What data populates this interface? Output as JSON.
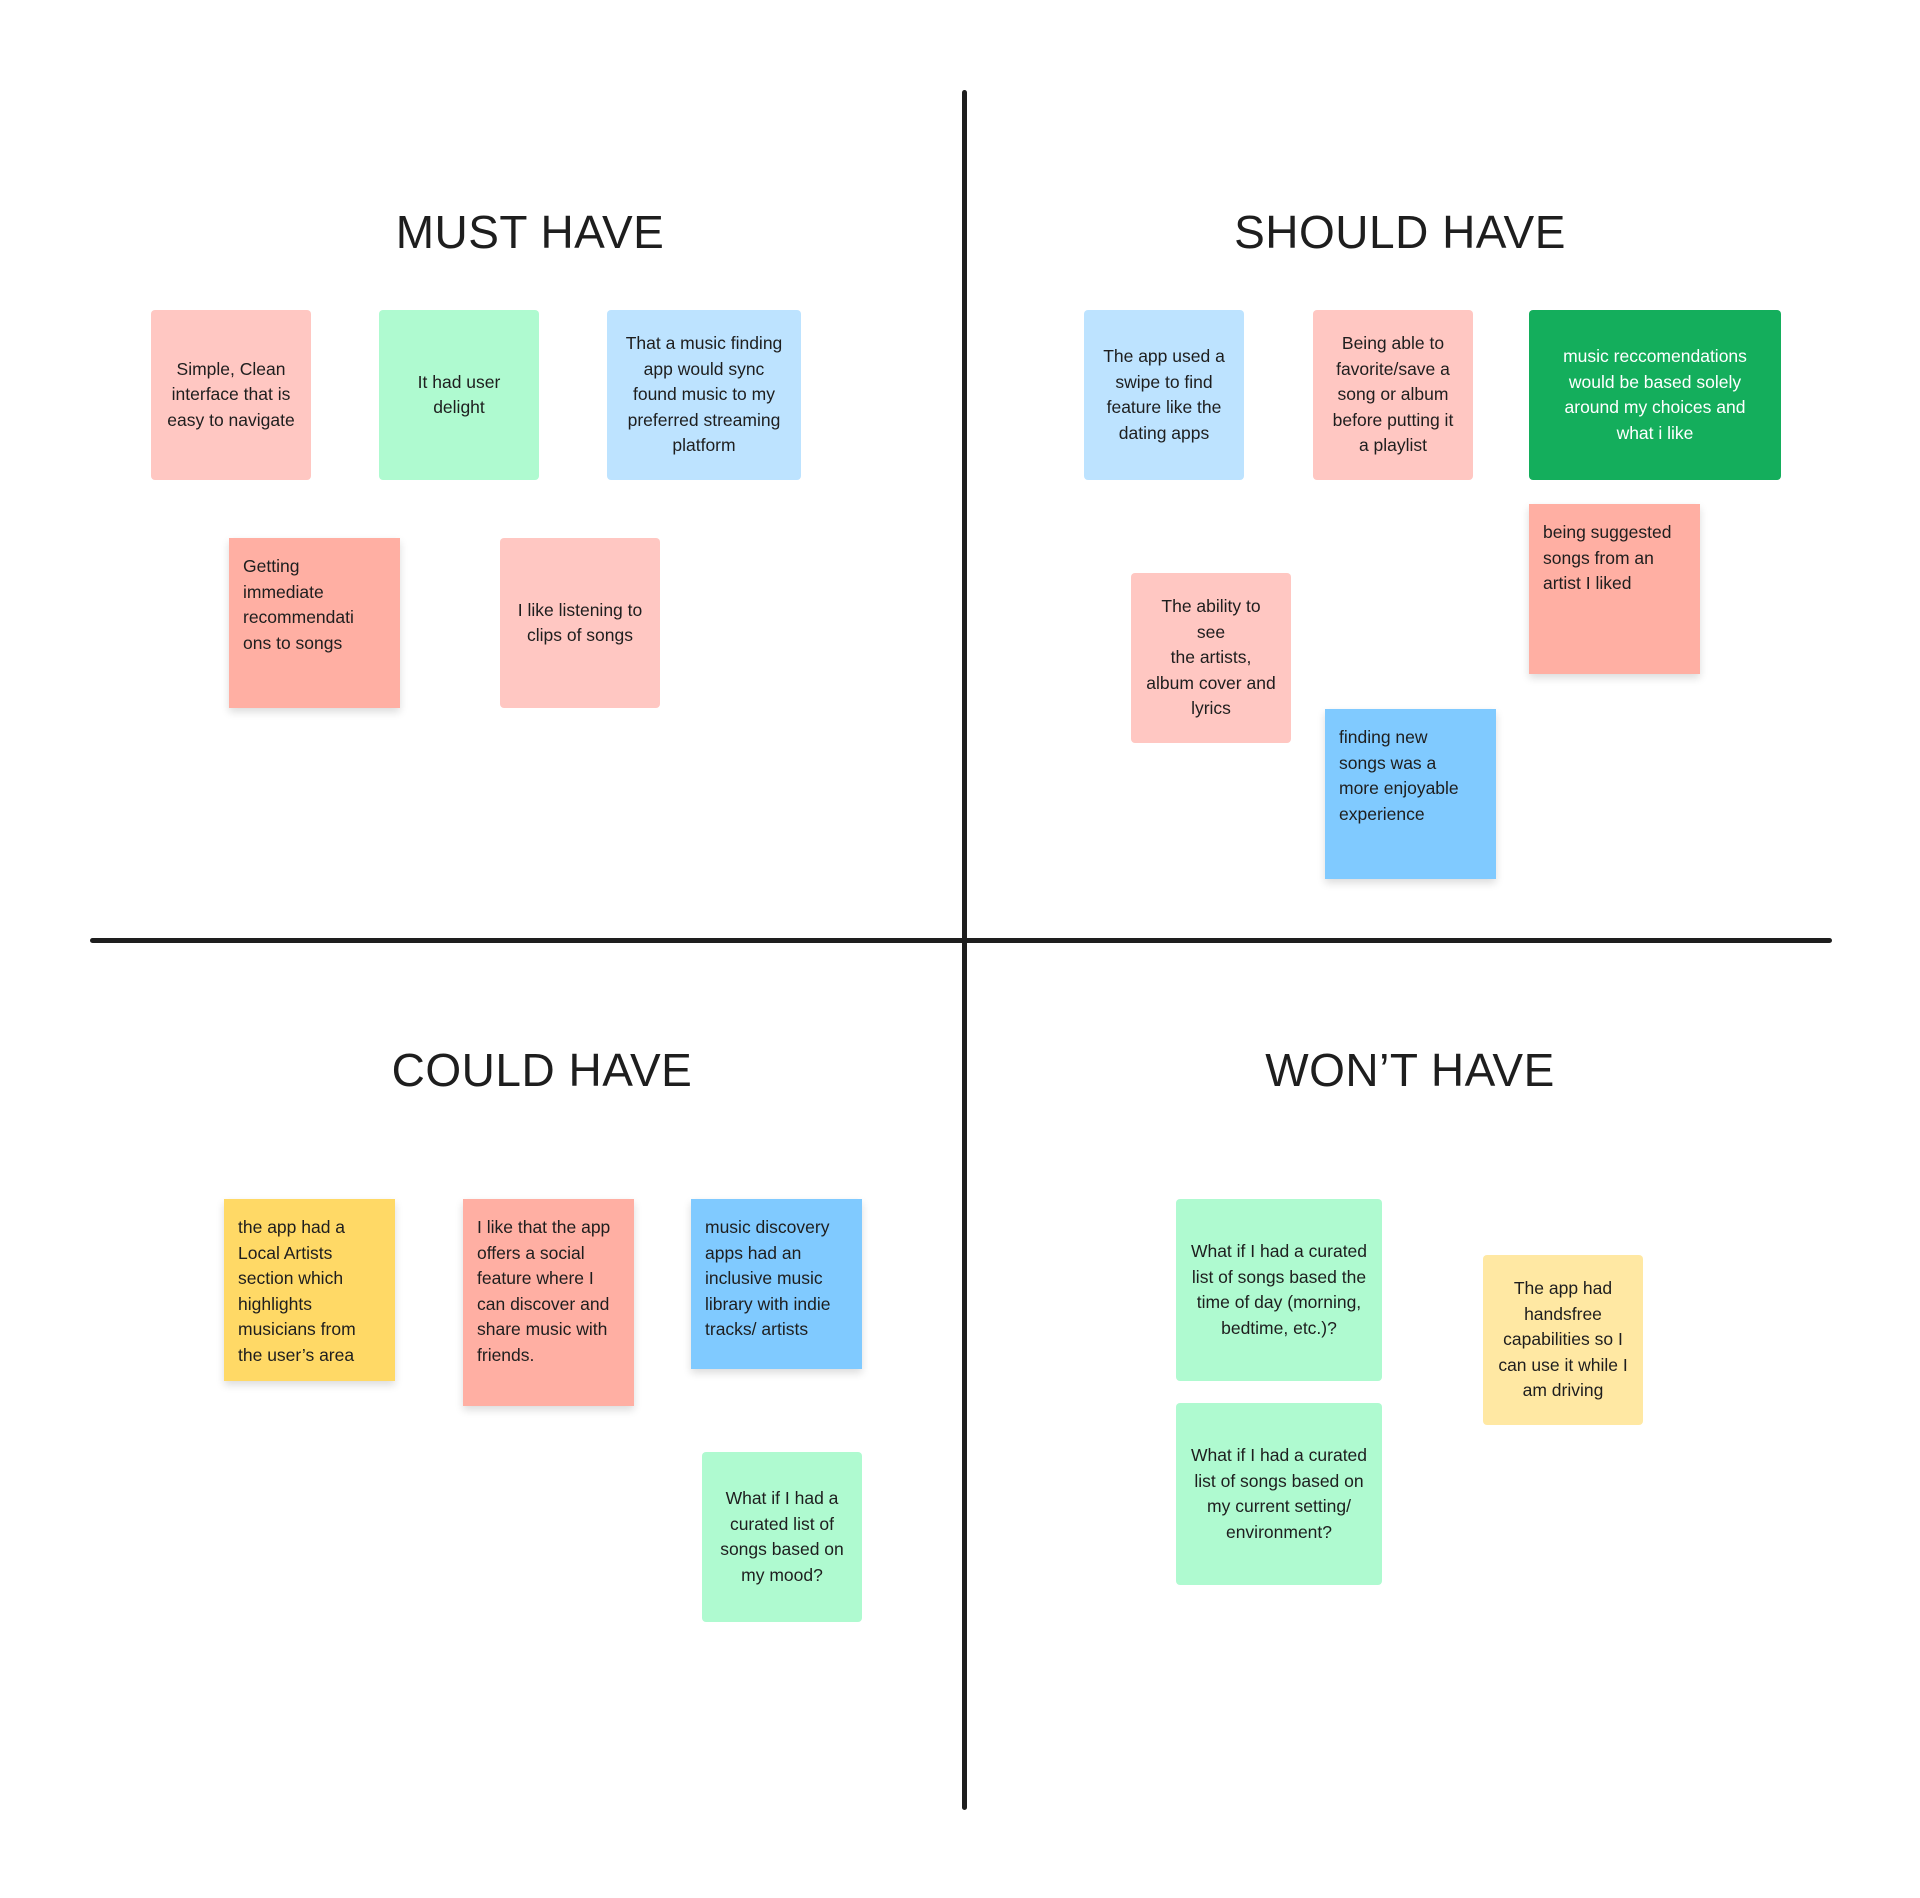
{
  "board": {
    "quadrants": [
      {
        "title": "MUST HAVE",
        "notes": [
          {
            "text": "Simple, Clean\ninterface that is\neasy to navigate",
            "color": "#ffc7c2"
          },
          {
            "text": "It had user\ndelight",
            "color": "#affad0"
          },
          {
            "text": "That a music finding\napp would sync\nfound music to my\npreferred streaming\nplatform",
            "color": "#bde3ff"
          },
          {
            "text": "Getting\nimmediate\nrecommendati\nons to songs",
            "color": "#ffafa3"
          },
          {
            "text": "I like listening to\nclips of songs",
            "color": "#ffc7c2"
          }
        ]
      },
      {
        "title": "SHOULD HAVE",
        "notes": [
          {
            "text": "The app used a\nswipe to find\nfeature like the\ndating apps",
            "color": "#bde3ff"
          },
          {
            "text": "Being able to\nfavorite/save a\nsong or album\nbefore putting it\na playlist",
            "color": "#ffc7c2"
          },
          {
            "text": "music reccomendations\nwould be based solely\naround my choices and\nwhat i like",
            "color": "#14ae5c"
          },
          {
            "text": "being suggested\nsongs from an\nartist I liked",
            "color": "#ffafa3"
          },
          {
            "text": "The ability to see\nthe artists,\nalbum cover and\nlyrics",
            "color": "#ffc7c2"
          },
          {
            "text": "finding new\nsongs was a\nmore enjoyable\nexperience",
            "color": "#80caff"
          }
        ]
      },
      {
        "title": "COULD HAVE",
        "notes": [
          {
            "text": "the app had a\nLocal Artists\nsection which\nhighlights\nmusicians from\nthe user’s area",
            "color": "#ffd966"
          },
          {
            "text": "I like that the app\noffers a social\nfeature where I\ncan discover and\nshare music with\nfriends.",
            "color": "#ffafa3"
          },
          {
            "text": "music discovery\napps had an\ninclusive music\nlibrary with indie\ntracks/ artists",
            "color": "#80caff"
          },
          {
            "text": "What if I had a\ncurated list of\nsongs based on\nmy mood?",
            "color": "#affad0"
          }
        ]
      },
      {
        "title": "WON’T HAVE",
        "notes": [
          {
            "text": "What if I had a curated\nlist of songs based the\ntime of day (morning,\nbedtime, etc.)?",
            "color": "#affad0"
          },
          {
            "text": "What if I had a curated\nlist of songs based on\nmy current setting/\nenvironment?",
            "color": "#affad0"
          },
          {
            "text": "The app had\nhandsfree\ncapabilities so I\ncan use it while I\nam driving",
            "color": "#ffe8a3"
          }
        ]
      }
    ]
  }
}
